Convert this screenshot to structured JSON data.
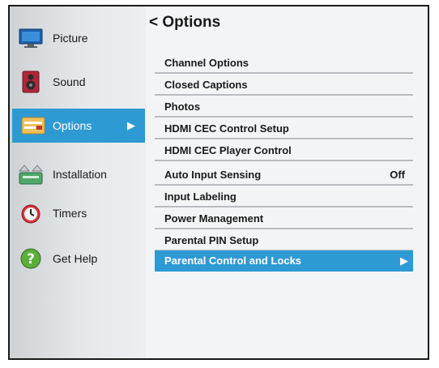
{
  "sidebar": {
    "items": [
      {
        "label": "Picture",
        "icon": "picture-icon"
      },
      {
        "label": "Sound",
        "icon": "speaker-icon"
      },
      {
        "label": "Options",
        "icon": "options-icon",
        "selected": true
      },
      {
        "label": "Installation",
        "icon": "installation-icon"
      },
      {
        "label": "Timers",
        "icon": "timer-icon"
      },
      {
        "label": "Get Help",
        "icon": "help-icon"
      }
    ]
  },
  "main": {
    "back_symbol": "<",
    "title": "Options",
    "menu": [
      {
        "label": "Channel Options"
      },
      {
        "label": "Closed Captions"
      },
      {
        "label": "Photos"
      },
      {
        "label": "HDMI CEC Control Setup"
      },
      {
        "label": "HDMI CEC Player Control"
      },
      {
        "label": "Auto Input Sensing",
        "value": "Off"
      },
      {
        "label": "Input Labeling"
      },
      {
        "label": "Power Management"
      },
      {
        "label": "Parental PIN Setup"
      },
      {
        "label": "Parental Control and Locks",
        "selected": true
      }
    ]
  },
  "colors": {
    "accent": "#2e9ad3"
  }
}
